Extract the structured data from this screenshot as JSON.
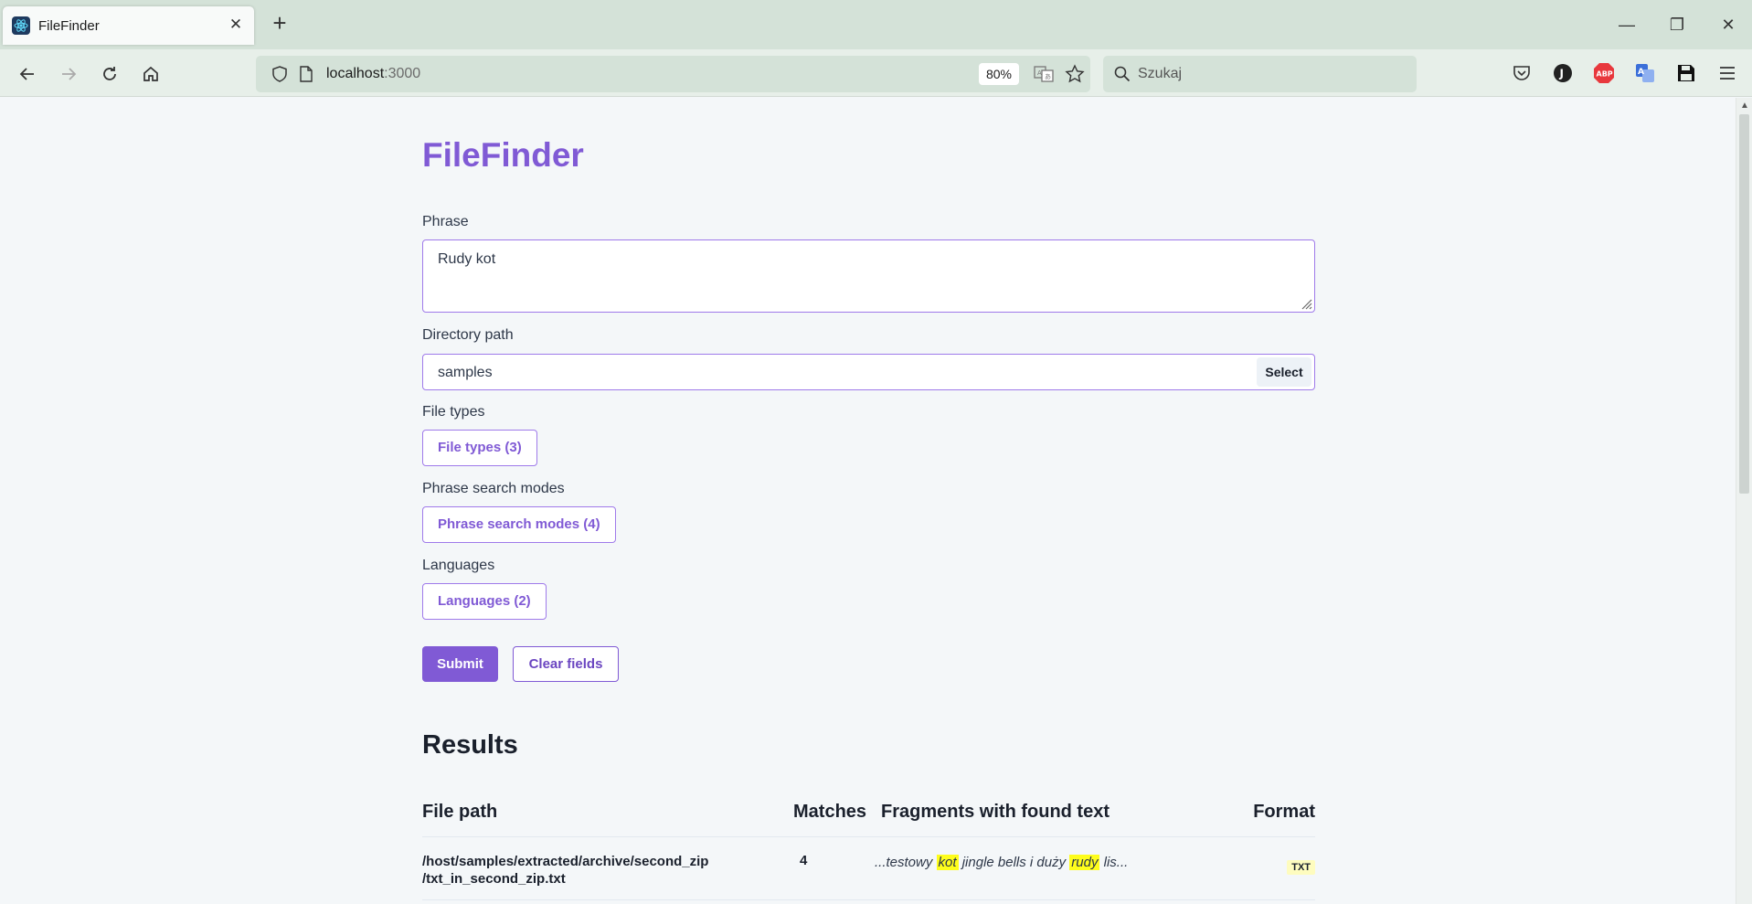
{
  "browser": {
    "tab_title": "FileFinder",
    "url_host": "localhost",
    "url_port": ":3000",
    "zoom": "80%",
    "search_placeholder": "Szukaj"
  },
  "app": {
    "title": "FileFinder",
    "phrase_label": "Phrase",
    "phrase_value": "Rudy kot",
    "directory_label": "Directory path",
    "directory_value": "samples",
    "select_label": "Select",
    "file_types_label": "File types",
    "file_types_button": "File types (3)",
    "modes_label": "Phrase search modes",
    "modes_button": "Phrase search modes (4)",
    "languages_label": "Languages",
    "languages_button": "Languages (2)",
    "submit_label": "Submit",
    "clear_label": "Clear fields"
  },
  "results": {
    "title": "Results",
    "headers": {
      "path": "File path",
      "matches": "Matches",
      "fragments": "Fragments with found text",
      "format": "Format"
    },
    "rows": [
      {
        "path_line1": "/host/samples/extracted/archive/second_zip",
        "path_line2": "/txt_in_second_zip.txt",
        "matches": "4",
        "fragment_pre": "...testowy ",
        "fragment_hl1": "kot",
        "fragment_mid": " jingle bells i duży ",
        "fragment_hl2": "rudy",
        "fragment_post": " lis...",
        "format": "TXT"
      }
    ]
  },
  "colors": {
    "accent": "#805ad5",
    "highlight": "#fefd1c"
  }
}
